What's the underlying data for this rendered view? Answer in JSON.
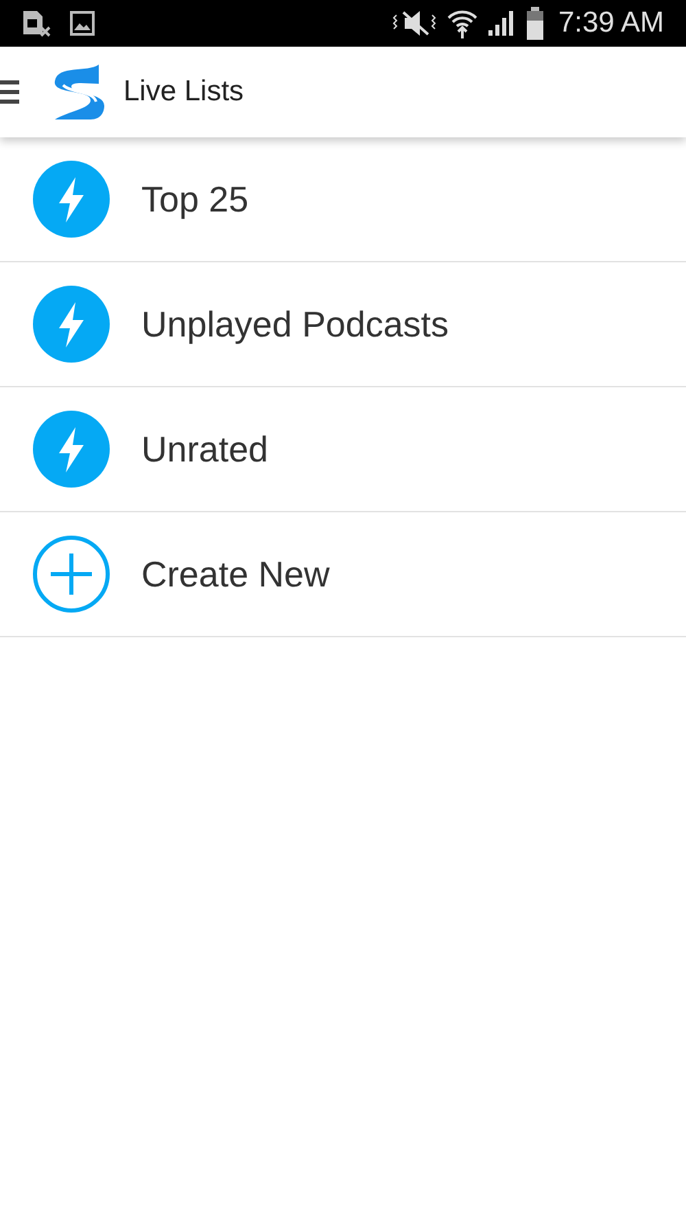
{
  "status_bar": {
    "time": "7:39 AM"
  },
  "app_bar": {
    "title": "Live Lists"
  },
  "lists": [
    {
      "label": "Top 25",
      "kind": "smart"
    },
    {
      "label": "Unplayed Podcasts",
      "kind": "smart"
    },
    {
      "label": "Unrated",
      "kind": "smart"
    },
    {
      "label": "Create New",
      "kind": "create"
    }
  ]
}
